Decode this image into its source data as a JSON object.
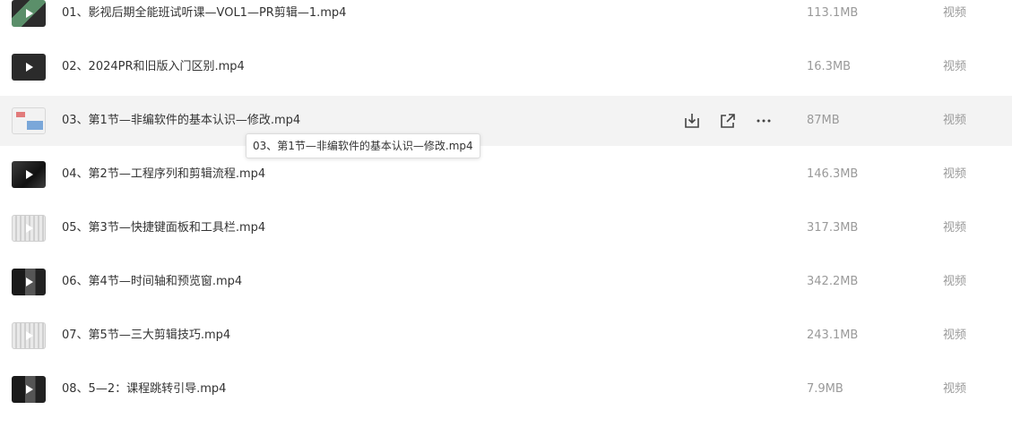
{
  "files": [
    {
      "name": "01、影视后期全能班试听课—VOL1—PR剪辑—1.mp4",
      "size": "113.1MB",
      "type": "视频",
      "thumb": "thumb-green"
    },
    {
      "name": "02、2024PR和旧版入门区别.mp4",
      "size": "16.3MB",
      "type": "视频",
      "thumb": "thumb-dark"
    },
    {
      "name": "03、第1节—非编软件的基本认识—修改.mp4",
      "size": "87MB",
      "type": "视频",
      "thumb": "thumb-slide"
    },
    {
      "name": "04、第2节—工程序列和剪辑流程.mp4",
      "size": "146.3MB",
      "type": "视频",
      "thumb": "thumb-dark2"
    },
    {
      "name": "05、第3节—快捷键面板和工具栏.mp4",
      "size": "317.3MB",
      "type": "视频",
      "thumb": "thumb-light"
    },
    {
      "name": "06、第4节—时间轴和预览窗.mp4",
      "size": "342.2MB",
      "type": "视频",
      "thumb": "thumb-mixed"
    },
    {
      "name": "07、第5节—三大剪辑技巧.mp4",
      "size": "243.1MB",
      "type": "视频",
      "thumb": "thumb-light"
    },
    {
      "name": "08、5—2：课程跳转引导.mp4",
      "size": "7.9MB",
      "type": "视频",
      "thumb": "thumb-mixed"
    }
  ],
  "hovered_index": 2,
  "tooltip": {
    "text": "03、第1节—非编软件的基本认识—修改.mp4"
  },
  "actions": [
    {
      "name": "download-icon"
    },
    {
      "name": "share-icon"
    },
    {
      "name": "more-icon"
    }
  ],
  "colors": {
    "hover_bg": "#f3f3f3",
    "text": "#333333",
    "muted": "#9a9a9a"
  }
}
